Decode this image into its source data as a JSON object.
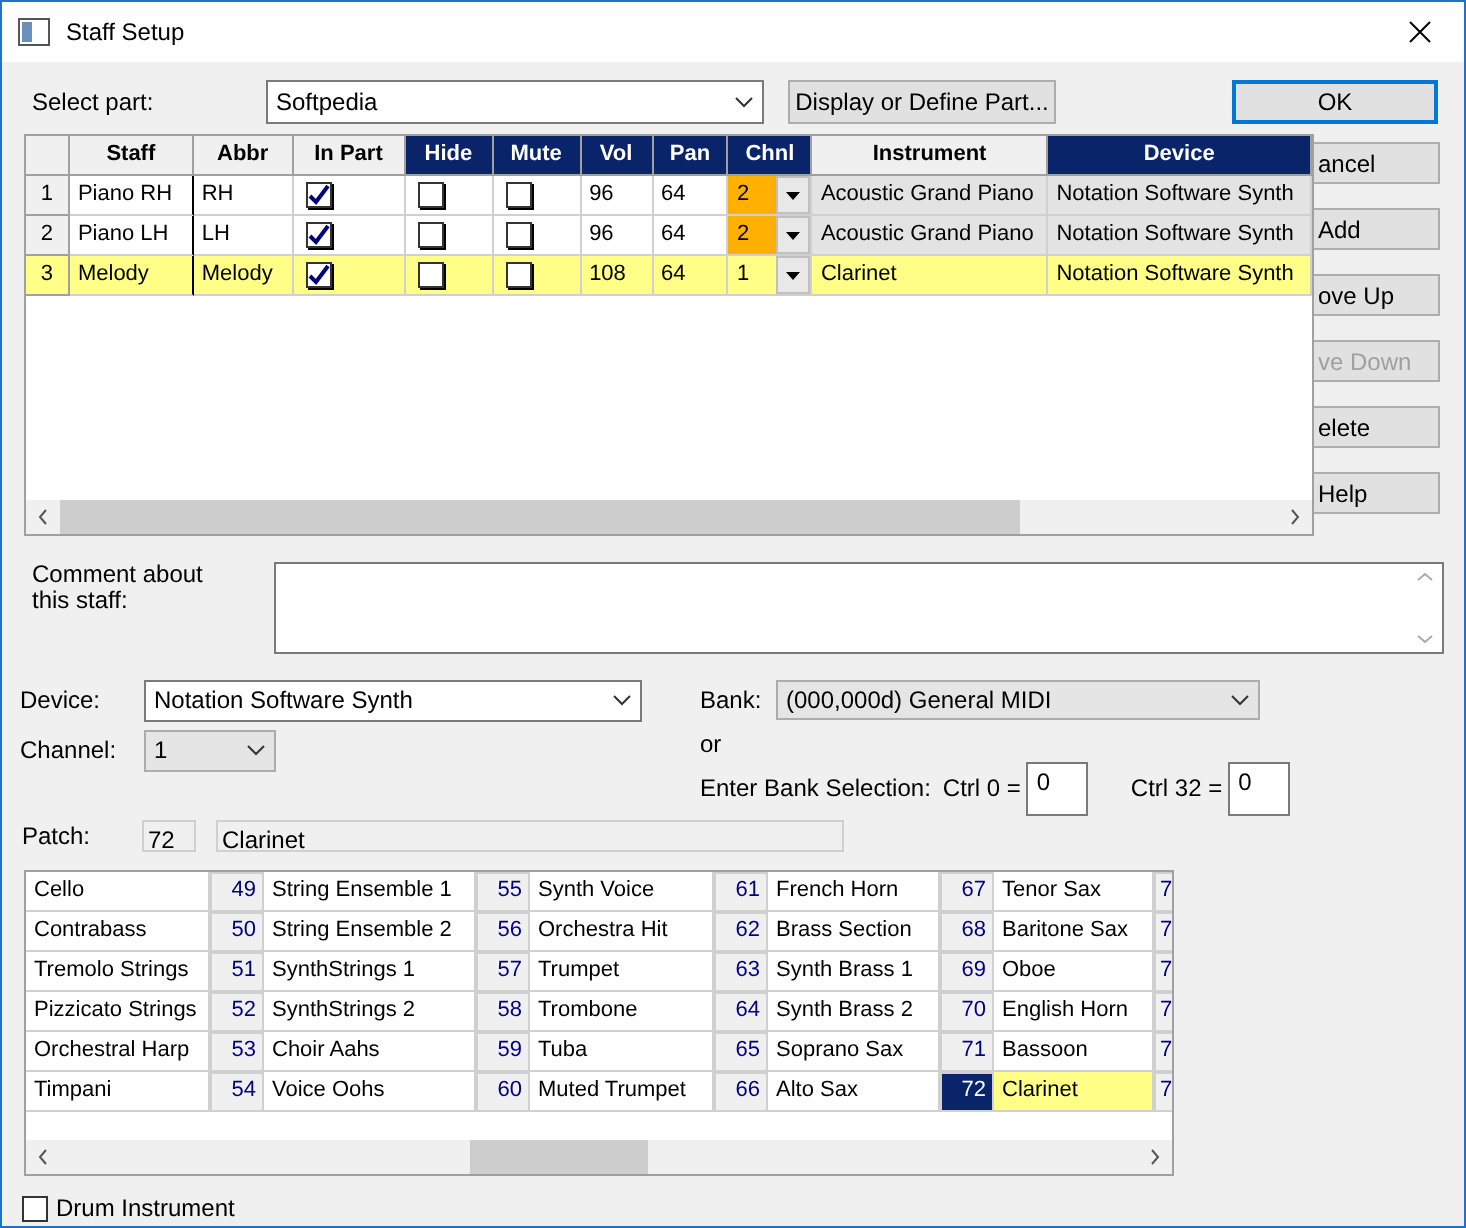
{
  "window": {
    "title": "Staff Setup"
  },
  "select_part": {
    "label": "Select part:",
    "value": "Softpedia",
    "define_button": "Display or Define Part..."
  },
  "ok_button": "OK",
  "side_buttons": [
    {
      "label": "ancel",
      "disabled": false
    },
    {
      "label": "Add",
      "disabled": false
    },
    {
      "label": "ove Up",
      "disabled": false
    },
    {
      "label": "ve Down",
      "disabled": true
    },
    {
      "label": "elete",
      "disabled": false
    },
    {
      "label": "Help",
      "disabled": false
    }
  ],
  "staff_table": {
    "columns": [
      {
        "label": "Staff",
        "highlighted": false
      },
      {
        "label": "Abbr",
        "highlighted": false
      },
      {
        "label": "In Part",
        "highlighted": false
      },
      {
        "label": "Hide",
        "highlighted": true
      },
      {
        "label": "Mute",
        "highlighted": true
      },
      {
        "label": "Vol",
        "highlighted": true
      },
      {
        "label": "Pan",
        "highlighted": true
      },
      {
        "label": "Chnl",
        "highlighted": true
      },
      {
        "label": "Instrument",
        "highlighted": false
      },
      {
        "label": "Device",
        "highlighted": true
      }
    ],
    "rows": [
      {
        "number": "1",
        "staff": "Piano RH",
        "abbr": "RH",
        "in_part": true,
        "hide": false,
        "mute": false,
        "vol": "96",
        "pan": "64",
        "chnl": "2",
        "chnl_highlighted": true,
        "instrument": "Acoustic Grand Piano",
        "device": "Notation Software Synth",
        "selected": false
      },
      {
        "number": "2",
        "staff": "Piano LH",
        "abbr": "LH",
        "in_part": true,
        "hide": false,
        "mute": false,
        "vol": "96",
        "pan": "64",
        "chnl": "2",
        "chnl_highlighted": true,
        "instrument": "Acoustic Grand Piano",
        "device": "Notation Software Synth",
        "selected": false
      },
      {
        "number": "3",
        "staff": "Melody",
        "abbr": "Melody",
        "in_part": true,
        "hide": false,
        "mute": false,
        "vol": "108",
        "pan": "64",
        "chnl": "1",
        "chnl_highlighted": false,
        "instrument": "Clarinet",
        "device": "Notation Software Synth",
        "selected": true
      }
    ]
  },
  "comment": {
    "label": "Comment about this staff:"
  },
  "device": {
    "label": "Device:",
    "value": "Notation Software Synth"
  },
  "channel": {
    "label": "Channel:",
    "value": "1"
  },
  "bank": {
    "label": "Bank:",
    "value": "(000,000d) General MIDI",
    "or": "or",
    "enter_label": "Enter Bank Selection:",
    "ctrl0_label": "Ctrl 0 =",
    "ctrl0_value": "0",
    "ctrl32_label": "Ctrl 32 =",
    "ctrl32_value": "0"
  },
  "patch": {
    "label": "Patch:",
    "number": "72",
    "name": "Clarinet"
  },
  "patch_grid": {
    "rows": [
      {
        "cells": [
          {
            "name": "Cello",
            "selected": false
          },
          {
            "number": "49",
            "name": "String Ensemble 1",
            "selected": false
          },
          {
            "number": "55",
            "name": "Synth Voice",
            "selected": false
          },
          {
            "number": "61",
            "name": "French Horn",
            "selected": false
          },
          {
            "number": "67",
            "name": "Tenor Sax",
            "selected": false
          },
          {
            "number": "7",
            "selected": false
          }
        ]
      },
      {
        "cells": [
          {
            "name": "Contrabass",
            "selected": false
          },
          {
            "number": "50",
            "name": "String Ensemble 2",
            "selected": false
          },
          {
            "number": "56",
            "name": "Orchestra Hit",
            "selected": false
          },
          {
            "number": "62",
            "name": "Brass Section",
            "selected": false
          },
          {
            "number": "68",
            "name": "Baritone Sax",
            "selected": false
          },
          {
            "number": "7",
            "selected": false
          }
        ]
      },
      {
        "cells": [
          {
            "name": "Tremolo Strings",
            "selected": false
          },
          {
            "number": "51",
            "name": "SynthStrings 1",
            "selected": false
          },
          {
            "number": "57",
            "name": "Trumpet",
            "selected": false
          },
          {
            "number": "63",
            "name": "Synth Brass 1",
            "selected": false
          },
          {
            "number": "69",
            "name": "Oboe",
            "selected": false
          },
          {
            "number": "7",
            "selected": false
          }
        ]
      },
      {
        "cells": [
          {
            "name": "Pizzicato Strings",
            "selected": false
          },
          {
            "number": "52",
            "name": "SynthStrings 2",
            "selected": false
          },
          {
            "number": "58",
            "name": "Trombone",
            "selected": false
          },
          {
            "number": "64",
            "name": "Synth Brass 2",
            "selected": false
          },
          {
            "number": "70",
            "name": "English Horn",
            "selected": false
          },
          {
            "number": "7",
            "selected": false
          }
        ]
      },
      {
        "cells": [
          {
            "name": "Orchestral Harp",
            "selected": false
          },
          {
            "number": "53",
            "name": "Choir Aahs",
            "selected": false
          },
          {
            "number": "59",
            "name": "Tuba",
            "selected": false
          },
          {
            "number": "65",
            "name": "Soprano Sax",
            "selected": false
          },
          {
            "number": "71",
            "name": "Bassoon",
            "selected": false
          },
          {
            "number": "7",
            "selected": false
          }
        ]
      },
      {
        "cells": [
          {
            "name": "Timpani",
            "selected": false
          },
          {
            "number": "54",
            "name": "Voice Oohs",
            "selected": false
          },
          {
            "number": "60",
            "name": "Muted Trumpet",
            "selected": false
          },
          {
            "number": "66",
            "name": "Alto Sax",
            "selected": false
          },
          {
            "number": "72",
            "name": "Clarinet",
            "selected": true
          },
          {
            "number": "7",
            "selected": false
          }
        ]
      }
    ]
  },
  "drum": {
    "label": "Drum Instrument",
    "checked": false
  }
}
